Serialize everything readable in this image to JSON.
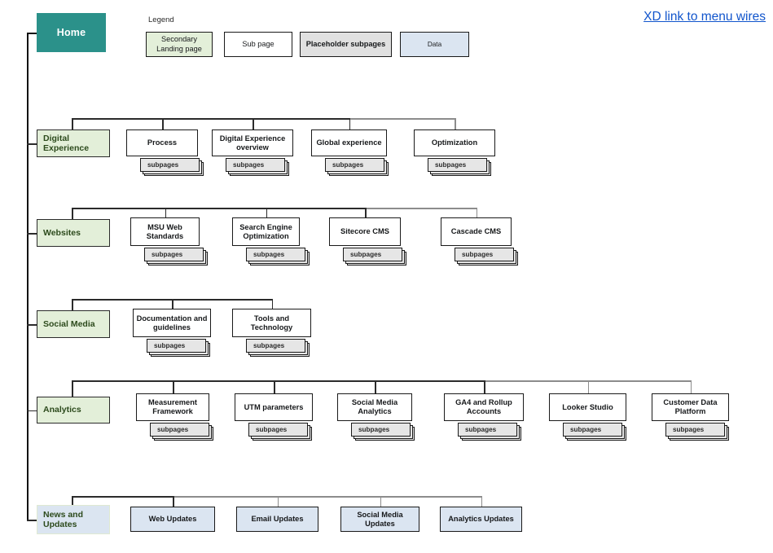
{
  "page": {
    "external_link": "XD link to menu wires"
  },
  "legend": {
    "title": "Legend",
    "items": [
      {
        "label": "Secondary\nLanding page",
        "style": "lg-green",
        "color": "#e3efd9"
      },
      {
        "label": "Sub page",
        "style": "lg-white",
        "color": "#ffffff"
      },
      {
        "label": "Placeholder subpages",
        "style": "lg-gray",
        "color": "#e0e0e0"
      },
      {
        "label": "Data",
        "style": "lg-blue",
        "color": "#dbe5f1"
      }
    ]
  },
  "root": {
    "label": "Home",
    "color": "#2b918a",
    "text_color": "#ffffff"
  },
  "placeholder_label": "subpages",
  "sections": [
    {
      "label": "Digital Experience",
      "tint": "green",
      "children": [
        {
          "label": "Process",
          "type": "subpage",
          "has_subpages": true
        },
        {
          "label": "Digital Experience overview",
          "type": "subpage",
          "has_subpages": true
        },
        {
          "label": "Global experience",
          "type": "subpage",
          "has_subpages": true
        },
        {
          "label": "Optimization",
          "type": "subpage",
          "has_subpages": true
        }
      ]
    },
    {
      "label": "Websites",
      "tint": "green",
      "children": [
        {
          "label": "MSU Web Standards",
          "type": "subpage",
          "has_subpages": true
        },
        {
          "label": "Search Engine Optimization",
          "type": "subpage",
          "has_subpages": true
        },
        {
          "label": "Sitecore CMS",
          "type": "subpage",
          "has_subpages": true
        },
        {
          "label": "Cascade CMS",
          "type": "subpage",
          "has_subpages": true
        }
      ]
    },
    {
      "label": "Social Media",
      "tint": "green",
      "children": [
        {
          "label": "Documentation and guidelines",
          "type": "subpage",
          "has_subpages": true
        },
        {
          "label": "Tools and Technology",
          "type": "subpage",
          "has_subpages": true
        }
      ]
    },
    {
      "label": "Analytics",
      "tint": "green",
      "children": [
        {
          "label": "Measurement Framework",
          "type": "subpage",
          "has_subpages": true
        },
        {
          "label": "UTM parameters",
          "type": "subpage",
          "has_subpages": true
        },
        {
          "label": "Social Media Analytics",
          "type": "subpage",
          "has_subpages": true
        },
        {
          "label": "GA4 and Rollup Accounts",
          "type": "subpage",
          "has_subpages": true
        },
        {
          "label": "Looker Studio",
          "type": "subpage",
          "has_subpages": true
        },
        {
          "label": "Customer Data Platform",
          "type": "subpage",
          "has_subpages": true
        }
      ]
    },
    {
      "label": "News and Updates",
      "tint": "data",
      "children": [
        {
          "label": "Web Updates",
          "type": "data",
          "has_subpages": false
        },
        {
          "label": "Email Updates",
          "type": "data",
          "has_subpages": false
        },
        {
          "label": "Social Media Updates",
          "type": "data",
          "has_subpages": false
        },
        {
          "label": "Analytics Updates",
          "type": "data",
          "has_subpages": false
        }
      ]
    }
  ]
}
